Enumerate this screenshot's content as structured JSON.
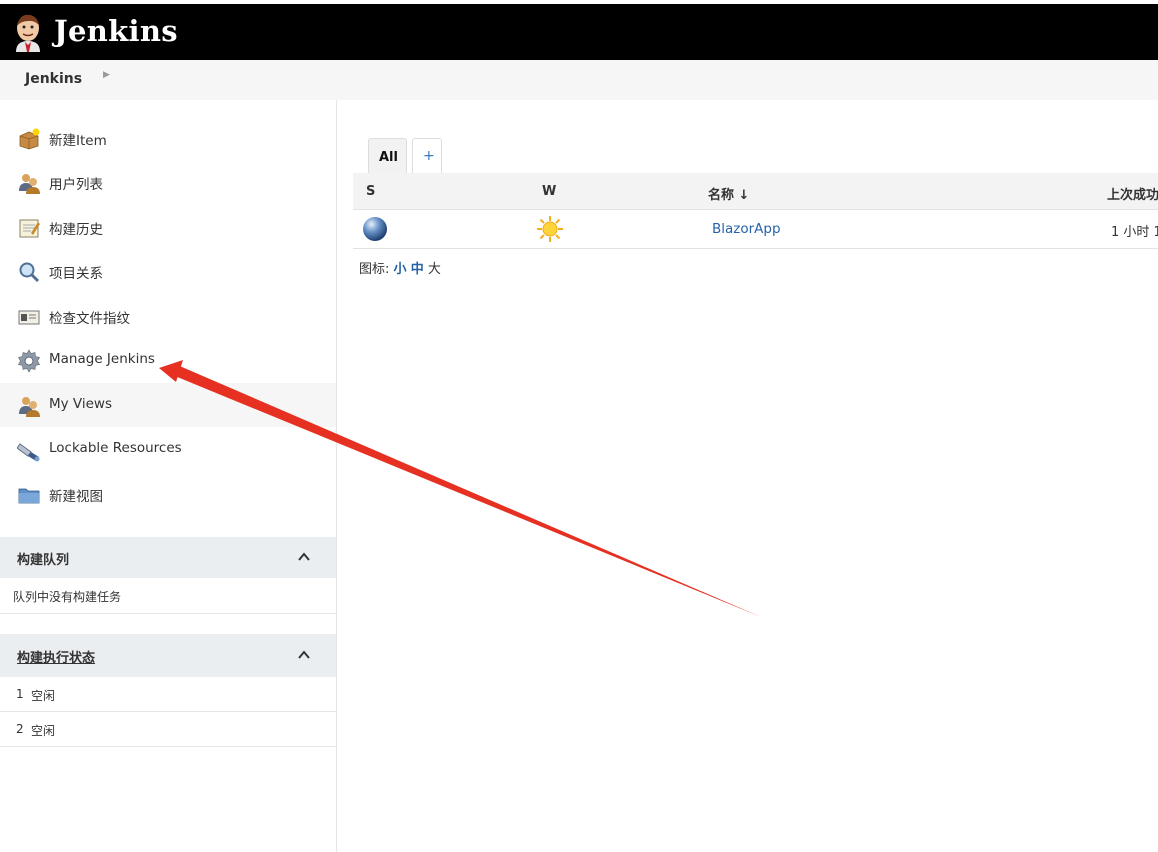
{
  "header": {
    "title": "Jenkins",
    "logo_icon": "jenkins-butler-icon",
    "background": "#000000"
  },
  "breadcrumb": {
    "items": [
      "Jenkins"
    ]
  },
  "sidebar": {
    "tasks": [
      {
        "label": "新建Item",
        "icon": "new-item-icon"
      },
      {
        "label": "用户列表",
        "icon": "users-icon"
      },
      {
        "label": "构建历史",
        "icon": "notepad-icon"
      },
      {
        "label": "项目关系",
        "icon": "magnifier-icon"
      },
      {
        "label": "检查文件指纹",
        "icon": "fingerprint-card-icon"
      },
      {
        "label": "Manage Jenkins",
        "icon": "gear-icon"
      },
      {
        "label": "My Views",
        "icon": "users-icon"
      },
      {
        "label": "Lockable Resources",
        "icon": "usb-lock-icon"
      },
      {
        "label": "新建视图",
        "icon": "folder-icon"
      }
    ],
    "build_queue": {
      "title": "构建队列",
      "empty_text": "队列中没有构建任务"
    },
    "executors": {
      "title": "构建执行状态",
      "rows": [
        {
          "num": "1",
          "status": "空闲"
        },
        {
          "num": "2",
          "status": "空闲"
        }
      ]
    }
  },
  "main": {
    "tabs": [
      {
        "label": "All",
        "active": true
      },
      {
        "label": "+"
      }
    ],
    "table": {
      "headers": [
        "S",
        "W",
        "名称 ↓",
        "上次成功"
      ],
      "rows": [
        {
          "status_icon": "blue-ball-icon",
          "weather_icon": "sun-icon",
          "name": "BlazorApp",
          "last_success": "1 小时 1"
        }
      ]
    },
    "icon_size": {
      "label": "图标:",
      "small": "小",
      "medium": "中",
      "large": "大"
    }
  },
  "colors": {
    "link": "#2763a8",
    "annotation_arrow": "#e53022"
  }
}
